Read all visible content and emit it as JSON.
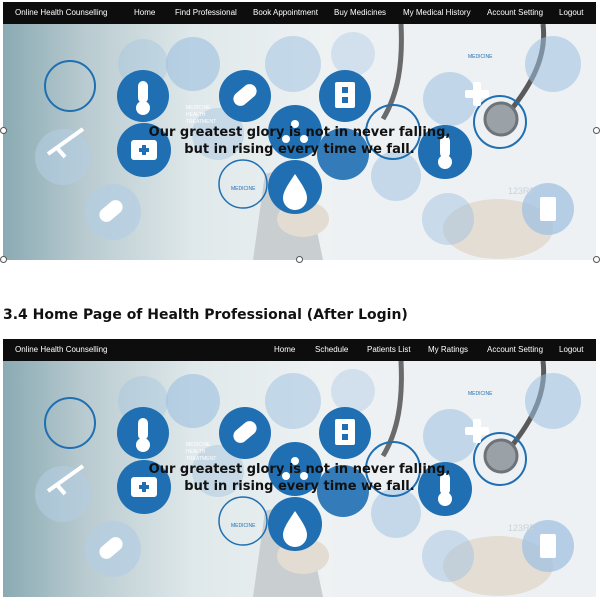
{
  "screen1": {
    "brand": "Online Health Counselling",
    "nav": [
      "Home",
      "Find Professional",
      "Book Appointment",
      "Buy Medicines",
      "My Medical History",
      "Account Setting",
      "Logout"
    ],
    "quote_line1": "Our greatest glory is not in never falling,",
    "quote_line2": "but in rising every time we fall.",
    "tag_medicine": "MEDICINE",
    "tag_block": [
      "MEDICINE",
      "HEALTH",
      "TREATMENT"
    ],
    "watermark": "123RF"
  },
  "section_heading": "3.4 Home Page of Health Professional (After Login)",
  "screen2": {
    "brand": "Online Health Counselling",
    "nav": [
      "Home",
      "Schedule",
      "Patients List",
      "My Ratings",
      "Account Setting",
      "Logout"
    ],
    "quote_line1": "Our greatest glory is not in never falling,",
    "quote_line2": "but in rising every time we fall.",
    "tag_medicine": "MEDICINE",
    "tag_block": [
      "MEDICINE",
      "HEALTH",
      "TREATMENT"
    ],
    "watermark": "123RF"
  },
  "colors": {
    "navbar": "#0d0d0d",
    "icon_blue": "#1f6fb2",
    "light_blue": "#9cbfe0"
  },
  "icons": [
    "thermometer-icon",
    "pill-icon",
    "hospital-icon",
    "first-aid-kit-icon",
    "molecule-icon",
    "droplet-icon",
    "cross-icon",
    "syringe-icon",
    "stethoscope-icon"
  ]
}
